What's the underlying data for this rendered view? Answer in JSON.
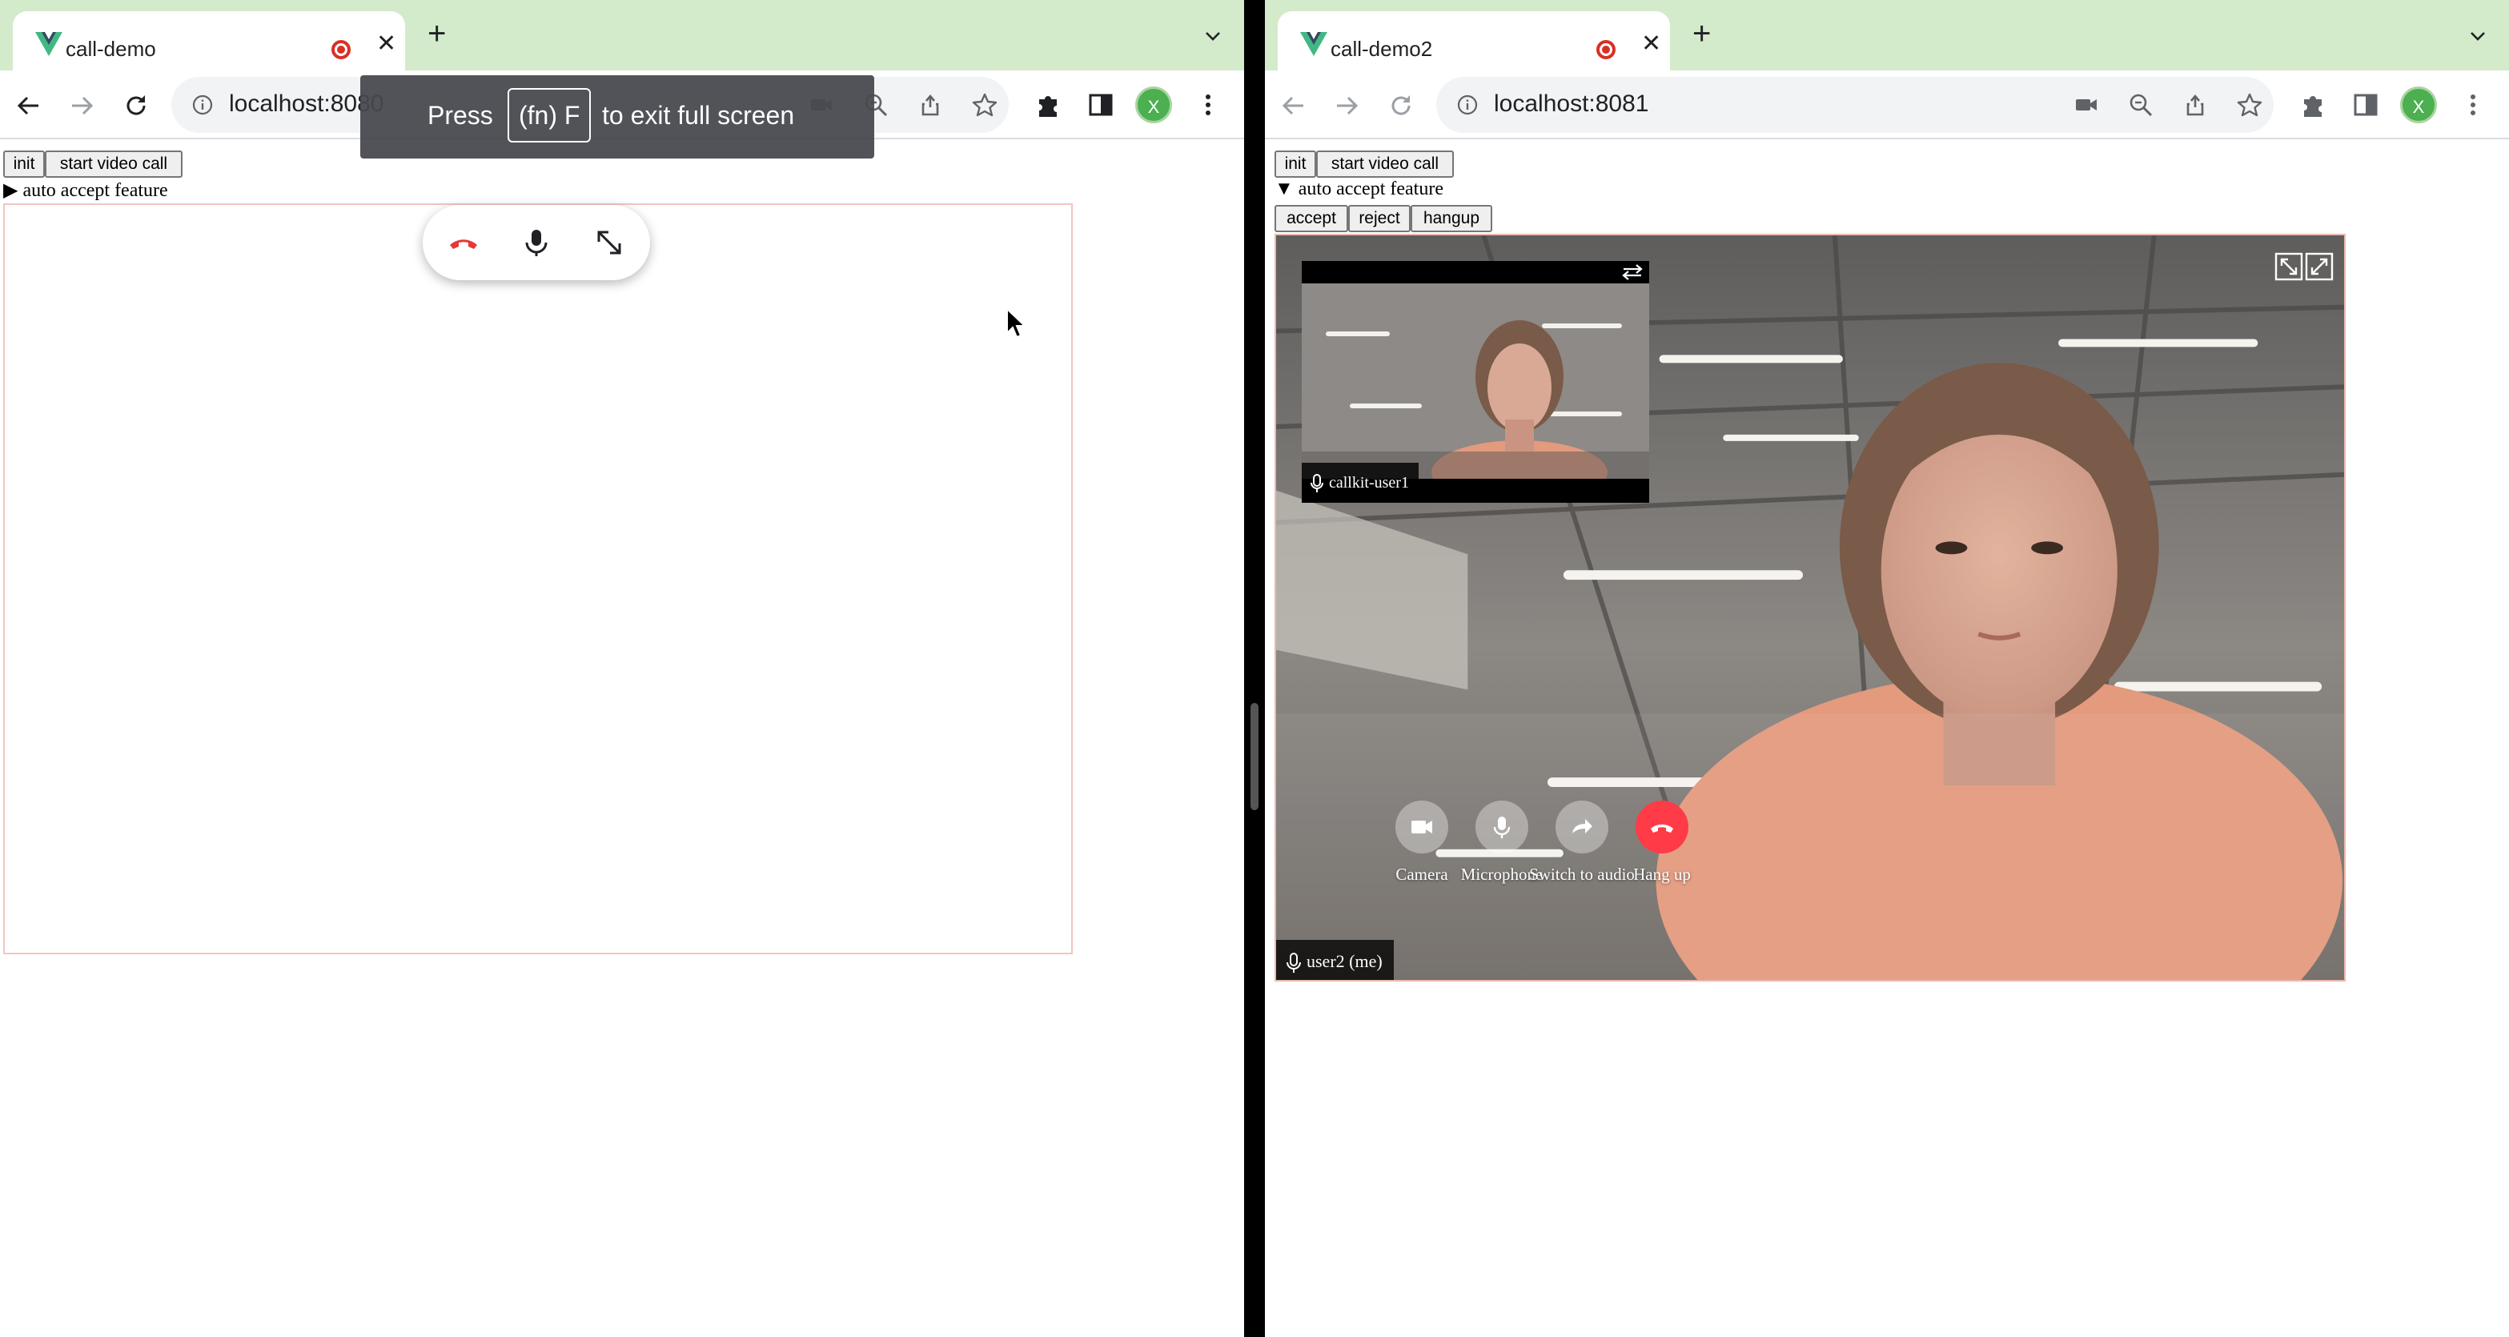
{
  "left_window": {
    "tab": {
      "title": "call-demo"
    },
    "address": {
      "url": "localhost:8080"
    },
    "profile_initial": "X",
    "buttons": {
      "init": "init",
      "start_video_call": "start video call"
    },
    "auto_accept": {
      "marker": "▶",
      "label": "auto accept feature",
      "expanded": false
    },
    "fullscreen_toast": {
      "press": "Press",
      "key": "(fn) F",
      "rest": "to exit full screen"
    }
  },
  "right_window": {
    "tab": {
      "title": "call-demo2"
    },
    "address": {
      "url": "localhost:8081"
    },
    "profile_initial": "X",
    "buttons": {
      "init": "init",
      "start_video_call": "start video call",
      "accept": "accept",
      "reject": "reject",
      "hangup": "hangup"
    },
    "auto_accept": {
      "marker": "▼",
      "label": "auto accept feature",
      "expanded": true
    },
    "call": {
      "remote_participant": "callkit-user1",
      "local_participant": "user2 (me)",
      "controls": [
        {
          "id": "camera",
          "label": "Camera",
          "icon": "camera-icon"
        },
        {
          "id": "microphone",
          "label": "Microphone",
          "icon": "microphone-icon"
        },
        {
          "id": "switch_audio",
          "label": "Switch to audio",
          "icon": "switch-to-audio-icon"
        },
        {
          "id": "hangup",
          "label": "Hang up",
          "icon": "phone-hangup-icon"
        }
      ]
    }
  },
  "colors": {
    "tab_strip": "#d3eacb",
    "hangup_red": "#ff3b48",
    "recording_red": "#d93025",
    "profile_green": "#4caf50"
  }
}
